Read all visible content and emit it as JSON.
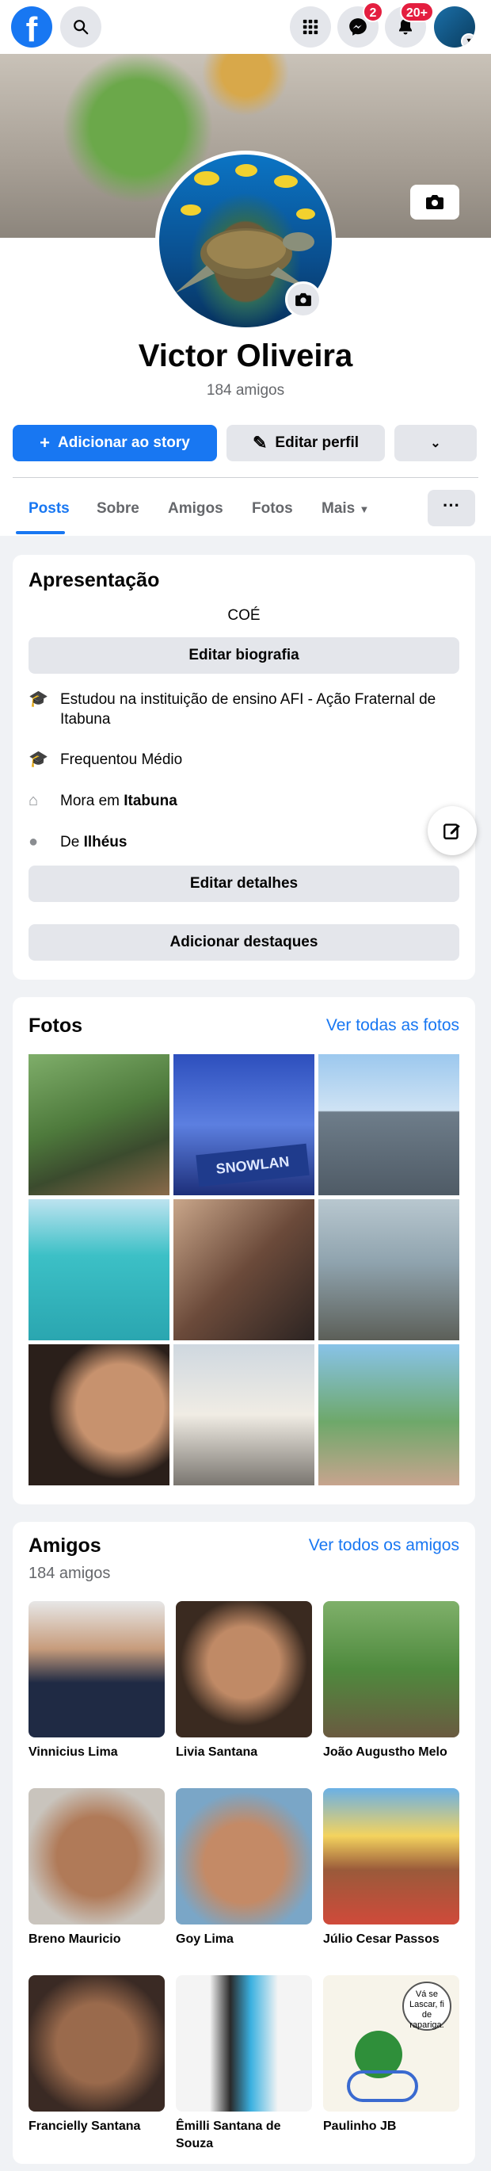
{
  "topbar": {
    "logo": "f",
    "messenger_badge": "2",
    "notifications_badge": "20+",
    "icons": [
      "search-icon",
      "grid-menu-icon",
      "messenger-icon",
      "bell-icon"
    ]
  },
  "profile": {
    "name": "Victor Oliveira",
    "friends_count": "184 amigos"
  },
  "actions": {
    "add_story": "Adicionar ao story",
    "edit_profile": "Editar perfil"
  },
  "tabs": [
    "Posts",
    "Sobre",
    "Amigos",
    "Fotos",
    "Mais"
  ],
  "intro": {
    "title": "Apresentação",
    "bio": "COÉ",
    "edit_bio": "Editar biografia",
    "details": [
      {
        "icon": "graduation-cap-icon",
        "text": "Estudou na instituição de ensino AFI - Ação Fraternal de Itabuna"
      },
      {
        "icon": "graduation-cap-icon",
        "text": "Frequentou Médio"
      },
      {
        "icon": "home-icon",
        "prefix": "Mora em ",
        "bold": "Itabuna"
      },
      {
        "icon": "location-pin-icon",
        "prefix": "De ",
        "bold": "Ilhéus"
      }
    ],
    "edit_details": "Editar detalhes",
    "add_highlights": "Adicionar destaques"
  },
  "photos": {
    "title": "Fotos",
    "see_all": "Ver todas as fotos",
    "snow_sign": "SNOWLAN"
  },
  "friends": {
    "title": "Amigos",
    "count": "184 amigos",
    "see_all": "Ver todos os amigos",
    "list": [
      "Vinnicius Lima",
      "Livia Santana",
      "João Augustho Melo",
      "Breno Mauricio",
      "Goy Lima",
      "Júlio Cesar Passos",
      "Francielly Santana",
      "Êmilli Santana de Souza",
      "Paulinho JB"
    ],
    "cartoon_text": "Vá se Lascar, fi de rapariga."
  },
  "colors": {
    "accent": "#1877f2",
    "badge": "#e41e3f"
  }
}
